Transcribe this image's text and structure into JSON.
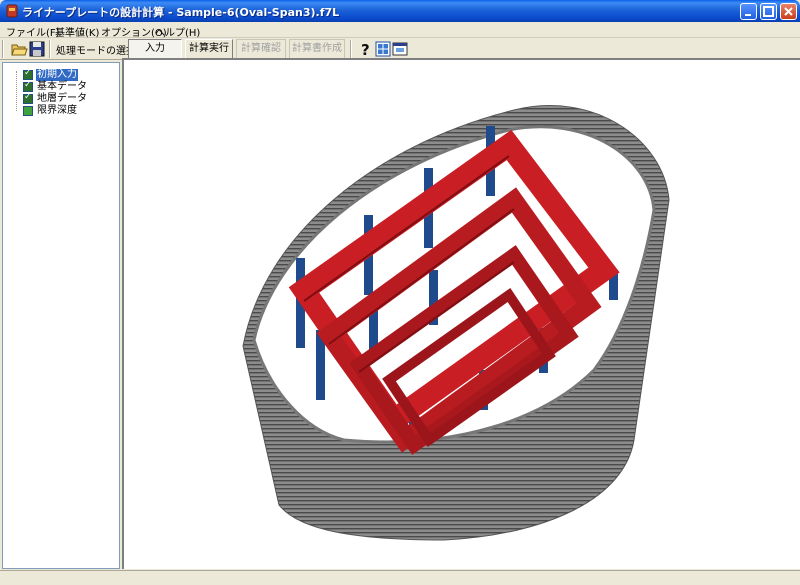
{
  "window": {
    "title": "ライナープレートの設計計算 - Sample-6(Oval-Span3).f7L"
  },
  "menu": {
    "items": [
      {
        "label": "ファイル(F)"
      },
      {
        "label": "基準値(K)"
      },
      {
        "label": "オプション(O)"
      },
      {
        "label": "ヘルプ(H)"
      }
    ]
  },
  "toolbar": {
    "mode_label": "処理モードの選択",
    "input_label": "入力",
    "run_label": "計算実行",
    "check_label": "計算確認",
    "report_label": "計算書作成"
  },
  "tree": {
    "items": [
      {
        "label": "初期入力"
      },
      {
        "label": "基本データ"
      },
      {
        "label": "地層データ"
      },
      {
        "label": "限界深度"
      }
    ]
  },
  "colors": {
    "titlebar": "#0b4ccf",
    "shell": "#8a8a8a",
    "ring": "#c81e24",
    "post": "#1f4a8c"
  }
}
